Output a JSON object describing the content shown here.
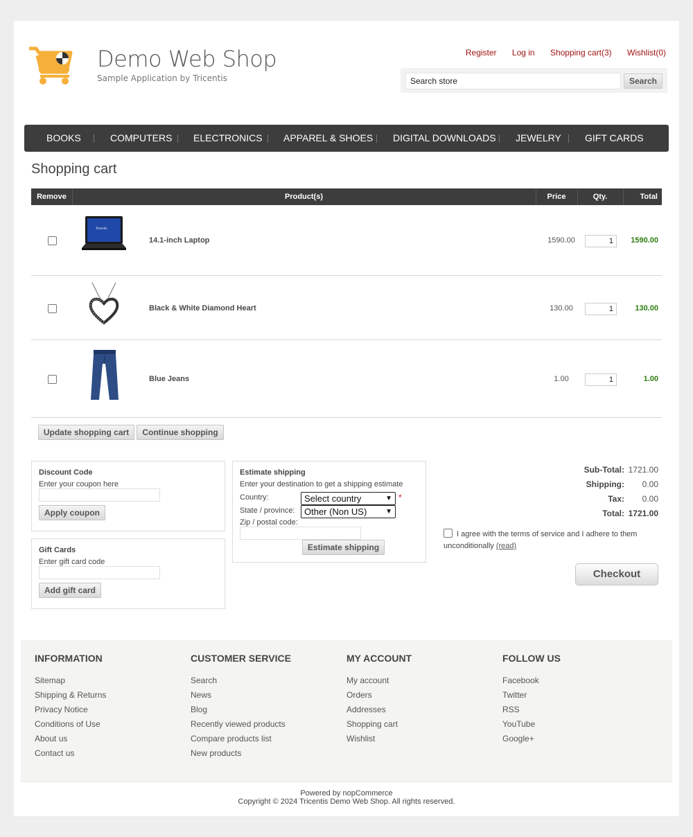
{
  "header": {
    "logo_title": "Demo Web Shop",
    "logo_subtitle": "Sample Application by Tricentis",
    "links": {
      "register": "Register",
      "login": "Log in",
      "cart": "Shopping cart(3)",
      "wishlist": "Wishlist(0)"
    },
    "search_placeholder": "Search store",
    "search_value": "Search store",
    "search_button": "Search"
  },
  "menu": [
    "BOOKS",
    "COMPUTERS",
    "ELECTRONICS",
    "APPAREL & SHOES",
    "DIGITAL DOWNLOADS",
    "JEWELRY",
    "GIFT CARDS"
  ],
  "page_title": "Shopping cart",
  "cart": {
    "headers": {
      "remove": "Remove",
      "products": "Product(s)",
      "price": "Price",
      "qty": "Qty.",
      "total": "Total"
    },
    "items": [
      {
        "name": "14.1-inch Laptop",
        "price": "1590.00",
        "qty": "1",
        "total": "1590.00",
        "image": "laptop-image"
      },
      {
        "name": "Black & White Diamond Heart",
        "price": "130.00",
        "qty": "1",
        "total": "130.00",
        "image": "heart-necklace-image"
      },
      {
        "name": "Blue Jeans",
        "price": "1.00",
        "qty": "1",
        "total": "1.00",
        "image": "jeans-image"
      }
    ],
    "update_button": "Update shopping cart",
    "continue_button": "Continue shopping"
  },
  "discount": {
    "title": "Discount Code",
    "hint": "Enter your coupon here",
    "button": "Apply coupon"
  },
  "giftcard": {
    "title": "Gift Cards",
    "hint": "Enter gift card code",
    "button": "Add gift card"
  },
  "shipping": {
    "title": "Estimate shipping",
    "hint": "Enter your destination to get a shipping estimate",
    "country_label": "Country:",
    "country_value": "Select country",
    "state_label": "State / province:",
    "state_value": "Other (Non US)",
    "zip_label": "Zip / postal code:",
    "button": "Estimate shipping",
    "required_mark": "*"
  },
  "totals": {
    "subtotal_label": "Sub-Total:",
    "subtotal": "1721.00",
    "shipping_label": "Shipping:",
    "shipping": "0.00",
    "tax_label": "Tax:",
    "tax": "0.00",
    "total_label": "Total:",
    "total": "1721.00"
  },
  "terms": {
    "text": "I agree with the terms of service and I adhere to them unconditionally",
    "link": "(read)"
  },
  "checkout_button": "Checkout",
  "footer": {
    "columns": [
      {
        "title": "INFORMATION",
        "links": [
          "Sitemap",
          "Shipping & Returns",
          "Privacy Notice",
          "Conditions of Use",
          "About us",
          "Contact us"
        ]
      },
      {
        "title": "CUSTOMER SERVICE",
        "links": [
          "Search",
          "News",
          "Blog",
          "Recently viewed products",
          "Compare products list",
          "New products"
        ]
      },
      {
        "title": "MY ACCOUNT",
        "links": [
          "My account",
          "Orders",
          "Addresses",
          "Shopping cart",
          "Wishlist"
        ]
      },
      {
        "title": "FOLLOW US",
        "links": [
          "Facebook",
          "Twitter",
          "RSS",
          "YouTube",
          "Google+"
        ]
      }
    ],
    "powered": "Powered by nopCommerce",
    "copyright": "Copyright © 2024 Tricentis Demo Web Shop. All rights reserved."
  },
  "colors": {
    "accent_link": "#9e0f0f",
    "menu_bg": "#3d3d3d",
    "total_green": "#2e7d0f",
    "logo_orange": "#f6b03a"
  }
}
